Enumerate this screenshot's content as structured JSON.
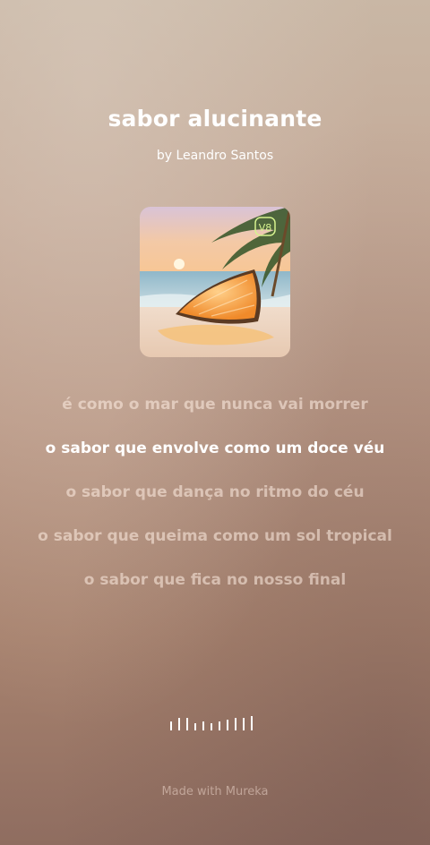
{
  "song": {
    "title": "sabor alucinante",
    "artist": "by Leandro Santos",
    "cover_badge": "V8"
  },
  "lyrics": [
    "é como o mar que nunca vai morrer",
    "o sabor que envolve como um doce véu",
    "o sabor que dança no ritmo do céu",
    "o sabor que queima como um sol tropical",
    "o sabor que fica no nosso final"
  ],
  "active_line_index": 1,
  "footer": "Made with Mureka"
}
